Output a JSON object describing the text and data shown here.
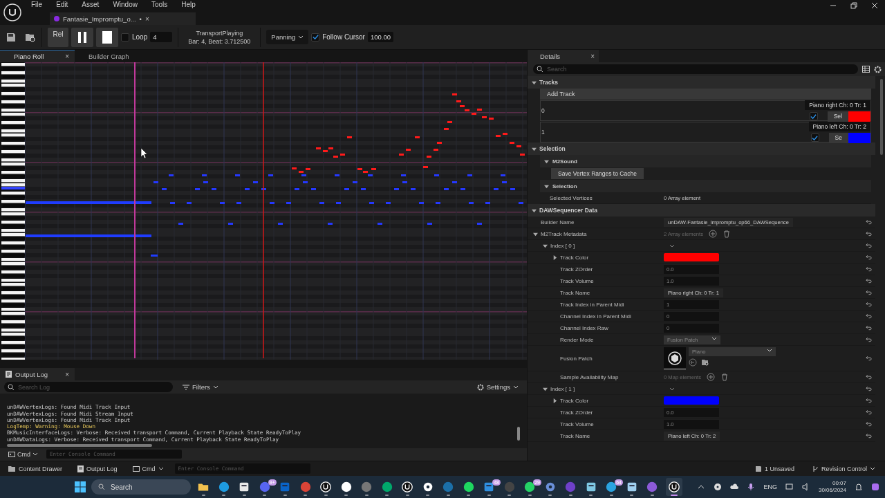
{
  "menu": [
    "File",
    "Edit",
    "Asset",
    "Window",
    "Tools",
    "Help"
  ],
  "document_tab": {
    "title": "Fantasie_Impromptu_o...",
    "modified": "•",
    "close": "×"
  },
  "toolbar": {
    "rel_button": "Rel",
    "loop": {
      "label": "Loop",
      "checked": false,
      "value": "4"
    },
    "transport": {
      "state": "TransportPlaying",
      "position": "Bar: 4, Beat: 3.712500"
    },
    "mode": "Panning",
    "follow_cursor": {
      "label": "Follow Cursor",
      "checked": true,
      "value": "100.00"
    }
  },
  "panel_tabs": [
    {
      "label": "Piano Roll",
      "selected": true,
      "close": "×"
    },
    {
      "label": "Builder Graph",
      "selected": false
    }
  ],
  "details": {
    "title": "Details",
    "close": "×",
    "search_placeholder": "Search",
    "categories": [
      {
        "kind": "tracks",
        "label": "Tracks",
        "expanded": true,
        "add_track": "Add Track",
        "tracks": [
          {
            "index": "0",
            "name": "Piano right Ch: 0 Tr: 1",
            "checked": true,
            "button": "Sel",
            "color": "#ff0000"
          },
          {
            "index": "1",
            "name": "Piano left Ch: 0 Tr: 2",
            "checked": true,
            "button": "Se",
            "color": "#0000ff"
          }
        ]
      },
      {
        "kind": "selection",
        "label": "Selection",
        "expanded": true,
        "groups": [
          {
            "label": "M2Sound",
            "expanded": true,
            "button": "Save Vertex Ranges to Cache"
          },
          {
            "label": "Selection",
            "expanded": true,
            "rows": [
              {
                "label": "Selected Vertices",
                "value": "0 Array element"
              }
            ]
          }
        ]
      },
      {
        "kind": "properties",
        "label": "DAWSequencer Data",
        "expanded": true,
        "rows": [
          {
            "kind": "text",
            "label": "Builder Name",
            "value": "unDAW-Fantasie_Impromptu_op66_DAWSequence"
          },
          {
            "kind": "array",
            "label": "M2Track Metadata",
            "value": "2 Array elements",
            "expanded": true,
            "children": [
              {
                "kind": "index",
                "label": "Index [ 0 ]",
                "expanded": true,
                "children": [
                  {
                    "kind": "color",
                    "label": "Track Color",
                    "expanded": false,
                    "color": "#ff0000"
                  },
                  {
                    "kind": "number",
                    "label": "Track ZOrder",
                    "value": "0.0"
                  },
                  {
                    "kind": "number",
                    "label": "Track Volume",
                    "value": "1.0"
                  },
                  {
                    "kind": "text",
                    "label": "Track Name",
                    "value": "Piano right Ch: 0 Tr: 1"
                  },
                  {
                    "kind": "number",
                    "label": "Track Index in Parent Midi",
                    "value": "1"
                  },
                  {
                    "kind": "number",
                    "label": "Channel Index in Parent Midi",
                    "value": "0"
                  },
                  {
                    "kind": "number",
                    "label": "Channel Index Raw",
                    "value": "0"
                  },
                  {
                    "kind": "combo",
                    "label": "Render Mode",
                    "value": "Fusion Patch"
                  },
                  {
                    "kind": "patch",
                    "label": "Fusion Patch",
                    "value": "Piano"
                  },
                  {
                    "kind": "array",
                    "label": "Sample Availability Map",
                    "value": "0 Map elements"
                  }
                ]
              },
              {
                "kind": "index",
                "label": "Index [ 1 ]",
                "expanded": true,
                "children": [
                  {
                    "kind": "color",
                    "label": "Track Color",
                    "expanded": false,
                    "color": "#0000ff"
                  },
                  {
                    "kind": "number",
                    "label": "Track ZOrder",
                    "value": "0.0"
                  },
                  {
                    "kind": "number",
                    "label": "Track Volume",
                    "value": "1.0"
                  },
                  {
                    "kind": "text",
                    "label": "Track Name",
                    "value": "Piano left Ch: 0 Tr: 2"
                  }
                ]
              }
            ]
          }
        ]
      }
    ]
  },
  "output_log": {
    "title": "Output Log",
    "close": "×",
    "search_placeholder": "Search Log",
    "filters": "Filters",
    "settings": "Settings",
    "lines": [
      {
        "kind": "info",
        "text": "unDAWVertexLogs: Found Midi Track Input"
      },
      {
        "kind": "info",
        "text": "unDAWVertexLogs: Found Midi Stream Input"
      },
      {
        "kind": "info",
        "text": "unDAWVertexLogs: Found Midi Track Input"
      },
      {
        "kind": "warning",
        "text": "LogTemp: Warning: Mouse Down"
      },
      {
        "kind": "info",
        "text": "BKMusicInterfaceLogs: Verbose: Received transport Command, Current Playback State ReadyToPlay"
      },
      {
        "kind": "info",
        "text": "unDAWDataLogs: Verbose: Received transport Command, Current Playback State ReadyToPlay"
      }
    ],
    "cmd": "Cmd",
    "cmd_placeholder": "Enter Console Command"
  },
  "status_bar": {
    "content_drawer": "Content Drawer",
    "output_log": "Output Log",
    "cmd": "Cmd",
    "cmd_placeholder": "Enter Console Command",
    "unsaved": "1 Unsaved",
    "revision_control": "Revision Control"
  },
  "taskbar": {
    "search": "Search",
    "apps": [
      {
        "selected": false
      },
      {
        "selected": false
      },
      {
        "selected": false
      },
      {
        "selected": false,
        "badge": "9+"
      },
      {
        "selected": false
      },
      {
        "selected": false
      },
      {
        "selected": false
      },
      {
        "selected": false
      },
      {
        "selected": false
      },
      {
        "selected": false
      },
      {
        "selected": false
      },
      {
        "selected": false
      },
      {
        "selected": false
      },
      {
        "selected": false
      },
      {
        "selected": false,
        "badge": "48"
      },
      {
        "selected": false
      },
      {
        "selected": false,
        "badge": "29"
      },
      {
        "selected": false
      },
      {
        "selected": false
      },
      {
        "selected": false
      },
      {
        "selected": false,
        "badge": "64"
      },
      {
        "selected": false
      },
      {
        "selected": false
      },
      {
        "selected": true
      }
    ],
    "language": "ENG",
    "time": "00:07",
    "date": "30/06/2024"
  }
}
